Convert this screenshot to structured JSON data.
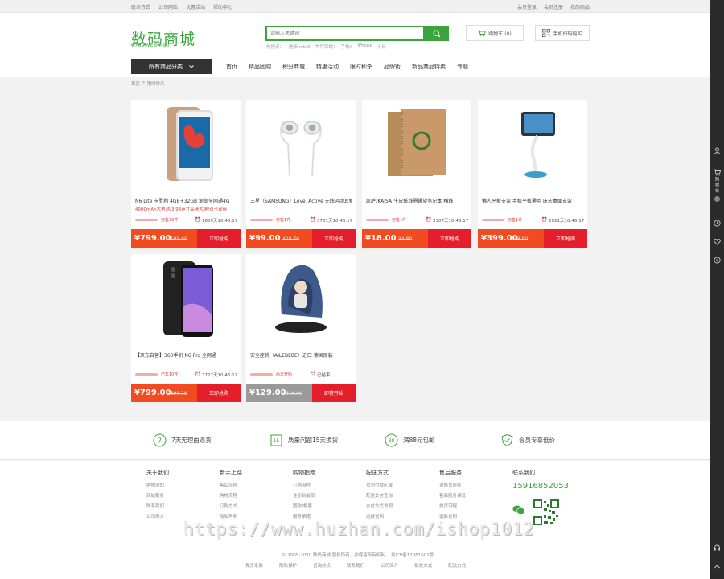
{
  "topbar": {
    "left_links": [
      "联系方式",
      "公司网站",
      "优惠活动",
      "帮助中心"
    ],
    "right_links": [
      "会员登录",
      "会员注册",
      "我的商品"
    ]
  },
  "header": {
    "logo_text": "数码商城",
    "logo_sub": "0769WEB.NET",
    "search_placeholder": "请输入关键词",
    "hot_words": [
      "热搜词：",
      "魅族note6",
      "华为荣耀7",
      "手机X",
      "iPhone",
      "小米"
    ],
    "cart_label": "购物车 (0)",
    "qr_label": "手机扫码购买"
  },
  "nav": {
    "category_label": "所有商品分类",
    "items": [
      "首页",
      "精品团购",
      "积分商城",
      "特惠活动",
      "限时秒杀",
      "品牌街",
      "新品商品特卖",
      "专题"
    ]
  },
  "breadcrumb": [
    "首页",
    ">",
    "限时秒杀"
  ],
  "products": [
    {
      "name": "N6 Lite 卡罗利 4GB+32GB 渐变全网通4G",
      "promo": "4000mAh大电池/3.93英寸高清大屏/双卡双待",
      "sold": "已售30件",
      "time": "1889天10:46:17",
      "price": "¥799.00",
      "old_price": "1198.00",
      "button": "立即抢购"
    },
    {
      "name": "三星（SAMSUNG）Level Active 无线运动耳机",
      "promo": "",
      "sold": "已售1件",
      "time": "3731天10:46:17",
      "price": "¥99.00",
      "old_price": "428.70",
      "button": "立即抢购"
    },
    {
      "name": "凯萨(KAISA)牛皮纸线圈螺旋笔记本 横线",
      "promo": "",
      "sold": "已售1件",
      "time": "3307天10:46:17",
      "price": "¥18.00",
      "old_price": "34.80",
      "button": "立即抢购"
    },
    {
      "name": "懒人平板支架 手机平板通用 床头桌面支架",
      "promo": "",
      "sold": "已售1件",
      "time": "2021天10:46:17",
      "price": "¥399.00",
      "old_price": "58.80",
      "button": "立即抢购"
    },
    {
      "name": "【京东自营】360手机 N6 Pro 全网通",
      "promo": "",
      "sold": "已售10件",
      "time": "3727天10:46:17",
      "price": "¥799.00",
      "old_price": "2398.79",
      "button": "立即抢购"
    },
    {
      "name": "安全座椅（AILEBEBE）进口 德国原装",
      "promo": "",
      "sold": "尚未开始",
      "time": "已结束",
      "price": "¥129.00",
      "old_price": "4416.00",
      "button": "即将开始"
    }
  ],
  "services": [
    {
      "icon": "seven-day-icon",
      "label": "7天无理由退货"
    },
    {
      "icon": "fifteen-day-icon",
      "label": "质量问题15天换货"
    },
    {
      "icon": "free-shipping-icon",
      "label": "满88元包邮"
    },
    {
      "icon": "member-icon",
      "label": "会员专享低价"
    }
  ],
  "footer": {
    "columns": [
      {
        "title": "关于我们",
        "items": [
          "购物须知",
          "商城服务",
          "联系我们",
          "公司简介"
        ]
      },
      {
        "title": "新手上路",
        "items": [
          "售后流程",
          "购物流程",
          "订购方式",
          "隐私声明"
        ]
      },
      {
        "title": "购物指南",
        "items": [
          "订购流程",
          "注册新会员",
          "团购/机票",
          "服务承诺"
        ]
      },
      {
        "title": "配送方式",
        "items": [
          "货到付款区域",
          "配送支付查询",
          "支付方式说明",
          "运费说明"
        ]
      },
      {
        "title": "售后服务",
        "items": [
          "退换货原则",
          "售后服务保证",
          "换货流程",
          "退款说明"
        ]
      }
    ],
    "contact_title": "联系我们",
    "phone": "15916852053",
    "watermark": "https://www.huzhan.com/ishop1012",
    "copyright": "© 2005-2020 数码商城 版权所有，并保留所有权利。 粤ICP备12061602号",
    "links": [
      "免责条款",
      "隐私保护",
      "咨询热点",
      "联系我们",
      "公司简介",
      "批发方式",
      "配送方式"
    ]
  },
  "colors": {
    "brand_green": "#3aa53c",
    "price_orange": "#f24b22",
    "buy_red": "#e41e2b"
  }
}
